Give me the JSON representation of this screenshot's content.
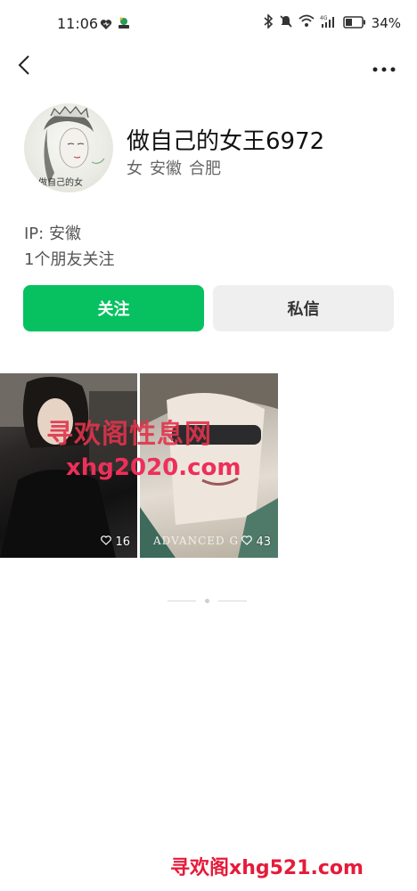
{
  "status_bar": {
    "time": "11:06",
    "battery": "34%",
    "icons": [
      "heart-icon",
      "app-icon",
      "bluetooth-icon",
      "mute-icon",
      "wifi-icon",
      "signal-icon",
      "battery-icon"
    ]
  },
  "nav": {
    "back_icon": "chevron-left-icon",
    "more_icon": "more-dots-icon"
  },
  "profile": {
    "nickname": "做自己的女王6972",
    "gender": "女",
    "province": "安徽",
    "city": "合肥",
    "avatar_caption": "做自己的女",
    "ip": "IP: 安徽",
    "friends": "1个朋友关注"
  },
  "actions": {
    "follow": "关注",
    "message": "私信"
  },
  "posts": [
    {
      "likes": "16"
    },
    {
      "likes": "43"
    }
  ],
  "photo_text": {
    "advanced": "ADVANCED G",
    "watermark_cn": "寻欢阁性息网",
    "watermark_url": "xhg2020.com"
  },
  "footer_watermark": "寻欢阁xhg521.com",
  "colors": {
    "follow_green": "#07c160",
    "watermark_red": "#e51b3a"
  }
}
